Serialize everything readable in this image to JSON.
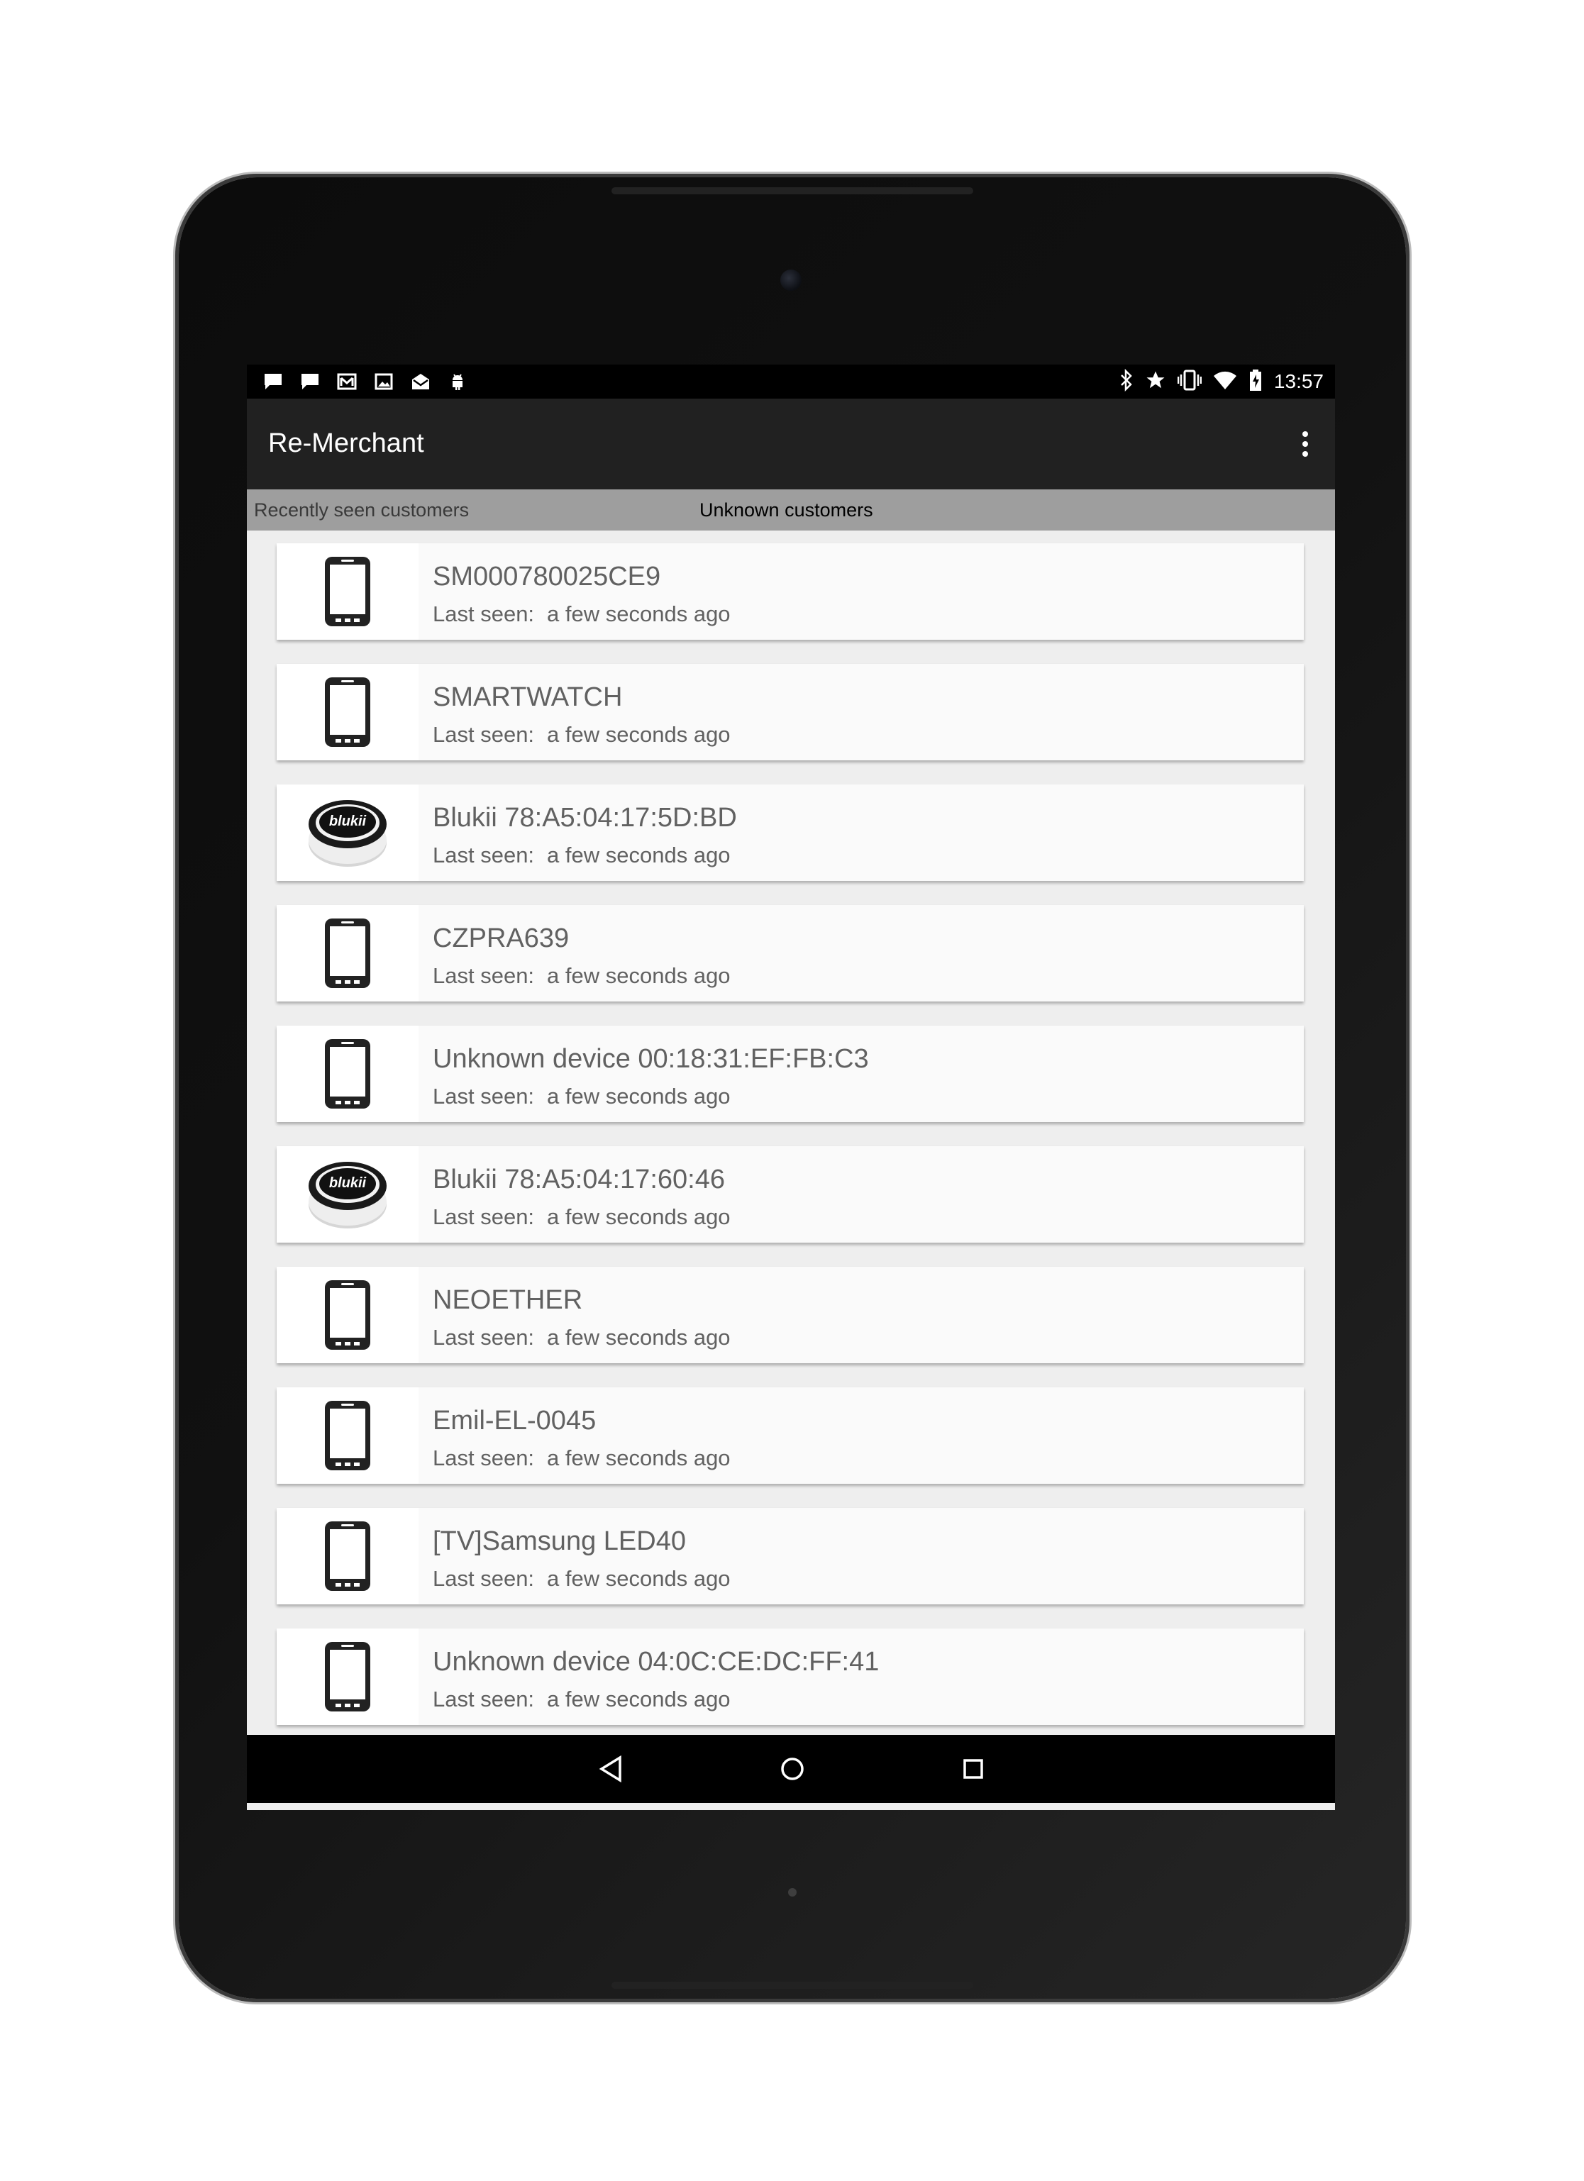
{
  "status_bar": {
    "time": "13:57",
    "left_icons": [
      "chat-icon",
      "chat-icon",
      "gmail-icon",
      "image-icon",
      "mail-icon",
      "android-icon"
    ],
    "right_icons": [
      "bluetooth-icon",
      "star-icon",
      "vibrate-icon",
      "wifi-icon",
      "battery-charging-icon"
    ]
  },
  "app_bar": {
    "title": "Re-Merchant",
    "overflow_icon": "more-vert-icon"
  },
  "tabs": {
    "recent": "Recently seen customers",
    "unknown": "Unknown customers"
  },
  "devices": [
    {
      "name": "SM000780025CE9",
      "last_seen_label": "Last seen:",
      "last_seen": "a few seconds ago",
      "icon": "smartphone-icon"
    },
    {
      "name": "SMARTWATCH",
      "last_seen_label": "Last seen:",
      "last_seen": "a few seconds ago",
      "icon": "smartphone-icon"
    },
    {
      "name": "Blukii 78:A5:04:17:5D:BD",
      "last_seen_label": "Last seen:",
      "last_seen": "a few seconds ago",
      "icon": "blukii-beacon-icon",
      "beacon_logo": "blukii"
    },
    {
      "name": "CZPRA639",
      "last_seen_label": "Last seen:",
      "last_seen": "a few seconds ago",
      "icon": "smartphone-icon"
    },
    {
      "name": "Unknown device 00:18:31:EF:FB:C3",
      "last_seen_label": "Last seen:",
      "last_seen": "a few seconds ago",
      "icon": "smartphone-icon"
    },
    {
      "name": "Blukii 78:A5:04:17:60:46",
      "last_seen_label": "Last seen:",
      "last_seen": "a few seconds ago",
      "icon": "blukii-beacon-icon",
      "beacon_logo": "blukii"
    },
    {
      "name": "NEOETHER",
      "last_seen_label": "Last seen:",
      "last_seen": "a few seconds ago",
      "icon": "smartphone-icon"
    },
    {
      "name": "Emil-EL-0045",
      "last_seen_label": "Last seen:",
      "last_seen": "a few seconds ago",
      "icon": "smartphone-icon"
    },
    {
      "name": "[TV]Samsung LED40",
      "last_seen_label": "Last seen:",
      "last_seen": "a few seconds ago",
      "icon": "smartphone-icon"
    },
    {
      "name": "Unknown device 04:0C:CE:DC:FF:41",
      "last_seen_label": "Last seen:",
      "last_seen": "a few seconds ago",
      "icon": "smartphone-icon"
    }
  ],
  "nav_bar": {
    "back": "back-icon",
    "home": "home-icon",
    "recents": "recents-icon"
  },
  "colors": {
    "app_bar": "#212121",
    "tab_bar": "#9e9e9e",
    "list_background": "#eeeeee",
    "card": "#fafafa",
    "text": "#616161"
  }
}
